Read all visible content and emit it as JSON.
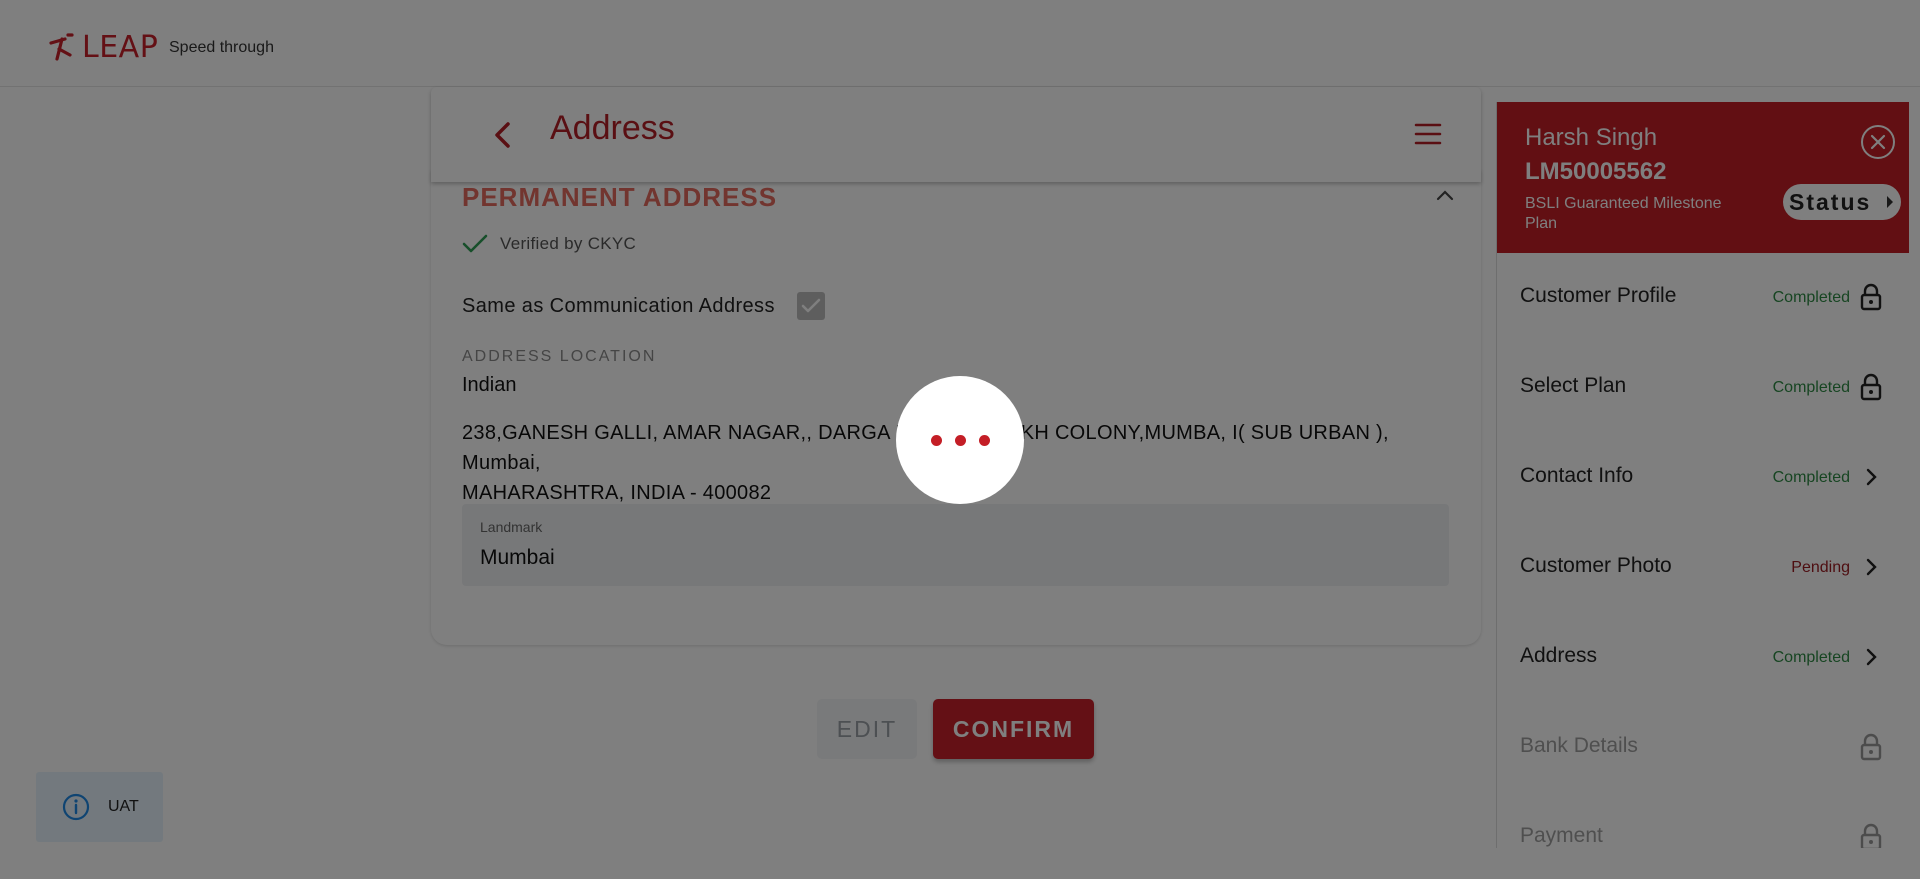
{
  "brand": {
    "logo_text": "LEAP",
    "tagline": "Speed through",
    "accent": "#c8202a"
  },
  "page": {
    "title": "Address"
  },
  "section": {
    "title": "PERMANENT ADDRESS",
    "verified_text": "Verified by CKYC",
    "same_as_label": "Same as Communication Address",
    "same_as_checked": true,
    "location_label": "ADDRESS LOCATION",
    "location_value": "Indian",
    "address_line1": "238,GANESH GALLI, AMAR NAGAR,, DARGA ROAD, FARUKH COLONY,MUMBA, I( SUB URBAN ), Mumbai,",
    "address_line2": "MAHARASHTRA, INDIA - 400082",
    "landmark_label": "Landmark",
    "landmark_value": "Mumbai"
  },
  "buttons": {
    "edit": "EDIT",
    "confirm": "CONFIRM"
  },
  "env_badge": {
    "label": "UAT"
  },
  "side_panel": {
    "customer_name": "Harsh Singh",
    "customer_id": "LM50005562",
    "plan_name": "BSLI Guaranteed Milestone Plan",
    "status_label": "Status",
    "steps": [
      {
        "label": "Customer Profile",
        "status": "Completed",
        "icon": "lock-icon"
      },
      {
        "label": "Select Plan",
        "status": "Completed",
        "icon": "lock-icon"
      },
      {
        "label": "Contact Info",
        "status": "Completed",
        "icon": "chevron-right-icon"
      },
      {
        "label": "Customer Photo",
        "status": "Pending",
        "icon": "chevron-right-icon"
      },
      {
        "label": "Address",
        "status": "Completed",
        "icon": "chevron-right-icon"
      },
      {
        "label": "Bank Details",
        "status": "",
        "icon": "lock-icon"
      },
      {
        "label": "Payment",
        "status": "",
        "icon": "lock-icon"
      }
    ]
  },
  "colors": {
    "completed": "#2e8b45",
    "pending": "#9c1c22",
    "header_red": "#c41e26"
  },
  "loading": {
    "visible": true
  }
}
